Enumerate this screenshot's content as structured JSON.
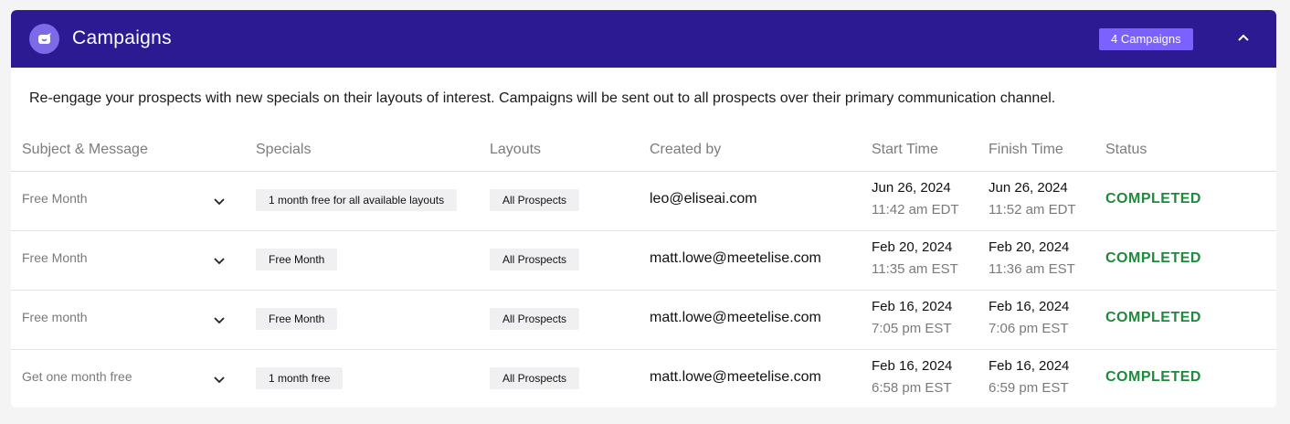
{
  "header": {
    "title": "Campaigns",
    "badge": "4 Campaigns",
    "logo_icon": "smile-bubble-icon",
    "collapse_icon": "chevron-up-icon"
  },
  "description": "Re-engage your prospects with new specials on their layouts of interest. Campaigns will be sent out to all prospects over their primary communication channel.",
  "columns": [
    "Subject & Message",
    "Specials",
    "Layouts",
    "Created by",
    "Start Time",
    "Finish Time",
    "Status"
  ],
  "rows": [
    {
      "subject": "Free Month",
      "special": "1 month free for all available layouts",
      "layout": "All Prospects",
      "created_by": "leo@eliseai.com",
      "start_date": "Jun 26, 2024",
      "start_time": "11:42 am EDT",
      "finish_date": "Jun 26, 2024",
      "finish_time": "11:52 am EDT",
      "status": "COMPLETED"
    },
    {
      "subject": "Free Month",
      "special": "Free Month",
      "layout": "All Prospects",
      "created_by": "matt.lowe@meetelise.com",
      "start_date": "Feb 20, 2024",
      "start_time": "11:35 am EST",
      "finish_date": "Feb 20, 2024",
      "finish_time": "11:36 am EST",
      "status": "COMPLETED"
    },
    {
      "subject": "Free month",
      "special": "Free Month",
      "layout": "All Prospects",
      "created_by": "matt.lowe@meetelise.com",
      "start_date": "Feb 16, 2024",
      "start_time": "7:05 pm EST",
      "finish_date": "Feb 16, 2024",
      "finish_time": "7:06 pm EST",
      "status": "COMPLETED"
    },
    {
      "subject": "Get one month free",
      "special": "1 month free",
      "layout": "All Prospects",
      "created_by": "matt.lowe@meetelise.com",
      "start_date": "Feb 16, 2024",
      "start_time": "6:58 pm EST",
      "finish_date": "Feb 16, 2024",
      "finish_time": "6:59 pm EST",
      "status": "COMPLETED"
    }
  ],
  "colors": {
    "header_bg": "#2b1a91",
    "badge_bg": "#7b61ff",
    "status_completed": "#1e8a3c"
  }
}
